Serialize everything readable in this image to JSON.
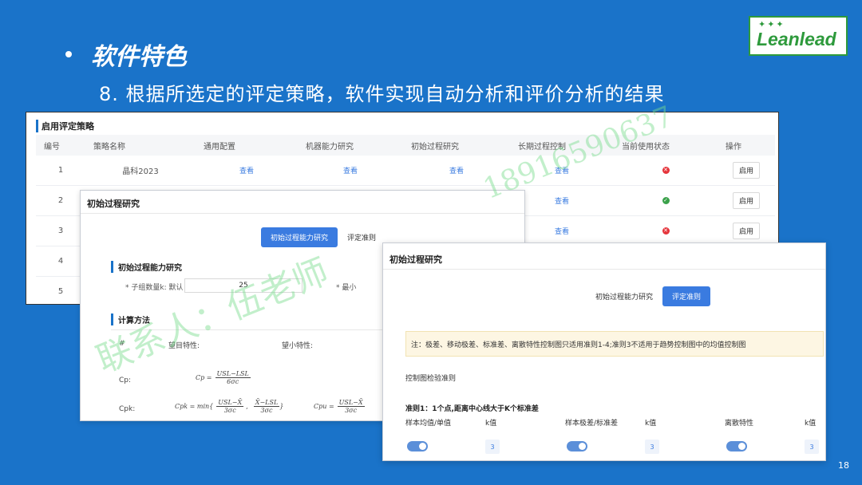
{
  "slide": {
    "bullet": "软件特色",
    "subtitle": "8.  根据所选定的评定策略，软件实现自动分析和评价分析的结果",
    "page_number": "18",
    "logo_text": "Leanlead",
    "logo_stars": "✦✦✦"
  },
  "colors": {
    "background": "#1a73c9",
    "accent": "#3a7be0",
    "logo_green": "#2e9a3c",
    "status_red": "#e5343b",
    "status_green": "#3aa14a"
  },
  "strategy_panel": {
    "title": "启用评定策略",
    "columns": [
      "编号",
      "策略名称",
      "通用配置",
      "机器能力研究",
      "初始过程研究",
      "长期过程控制",
      "当前使用状态",
      "操作"
    ],
    "rows": [
      {
        "no": "1",
        "name": "晶科2023",
        "general": "查看",
        "machine": "查看",
        "initial": "查看",
        "long_term": "查看",
        "status": "red",
        "action": "启用"
      },
      {
        "no": "2",
        "name": "",
        "general": "",
        "machine": "",
        "initial": "",
        "long_term": "查看",
        "status": "green",
        "action": "启用"
      },
      {
        "no": "3",
        "name": "",
        "general": "",
        "machine": "",
        "initial": "",
        "long_term": "查看",
        "status": "red",
        "action": "启用"
      },
      {
        "no": "4",
        "name": "",
        "general": "",
        "machine": "",
        "initial": "",
        "long_term": "",
        "status": "",
        "action": ""
      },
      {
        "no": "5",
        "name": "",
        "general": "",
        "machine": "",
        "initial": "",
        "long_term": "",
        "status": "",
        "action": ""
      }
    ]
  },
  "initial_panel": {
    "title": "初始过程研究",
    "tabs": [
      "初始过程能力研究",
      "评定准则"
    ],
    "section1": "初始过程能力研究",
    "subgroup_label": "* 子组数量k: 默认",
    "subgroup_value": "25",
    "min_label": "* 最小",
    "section2": "计算方法",
    "col_hash": "#",
    "col_target": "望目特性:",
    "col_small": "望小特性:",
    "row_cp": "Cp:",
    "row_cpk": "Cpk:",
    "cp_formula_lhs": "Cp =",
    "cp_formula_num": "USL−LSL",
    "cp_formula_den": "6σc",
    "cpk_formula_lhs": "Cpk = min{",
    "cpk_formula_a_num": "USL−X̄",
    "cpk_formula_a_den": "3σc",
    "cpk_formula_sep": ",",
    "cpk_formula_b_num": "X̄−LSL",
    "cpk_formula_b_den": "3σc",
    "cpk_formula_close": "}",
    "cpu_formula_lhs": "Cpu =",
    "cpu_formula_num": "USL−X̄",
    "cpu_formula_den": "3σc"
  },
  "criteria_panel": {
    "title": "初始过程研究",
    "tabs": [
      "初始过程能力研究",
      "评定准则"
    ],
    "note": "注：极差、移动极差、标准差、离散特性控制图只适用准则1-4;准则3不适用于趋势控制图中的均值控制图",
    "section": "控制图检验准则",
    "rule1": "准则1：1个点,距离中心线大于K个标准差",
    "group_labels": [
      "样本均值/单值",
      "样本极差/标准差",
      "离散特性"
    ],
    "k_label": "k值",
    "k_values": [
      "3",
      "3",
      "3"
    ]
  },
  "watermark": {
    "phone": "18916590637",
    "contact": "联系人：伍老师"
  }
}
